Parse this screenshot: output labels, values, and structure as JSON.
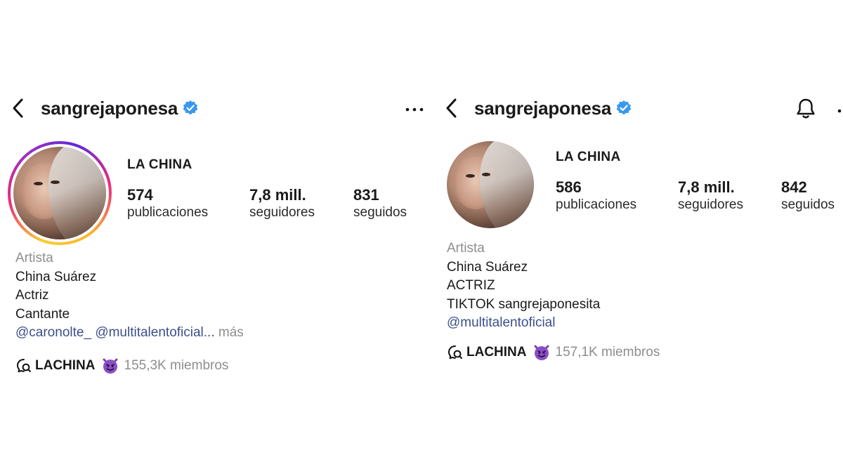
{
  "left": {
    "username": "sangrejaponesa",
    "display_name": "LA CHINA",
    "stats": [
      {
        "value": "574",
        "label": "publicaciones"
      },
      {
        "value": "7,8 mill.",
        "label": "seguidores"
      },
      {
        "value": "831",
        "label": "seguidos"
      }
    ],
    "bio": {
      "category": "Artista",
      "lines": [
        "China Suárez",
        "Actriz",
        "Cantante"
      ],
      "mention_1": "@caronolte_",
      "mention_2": "@multitalentoficial",
      "ellipsis": "...",
      "more": "más"
    },
    "channel": {
      "name": "LACHINA",
      "members": "155,3K miembros"
    }
  },
  "right": {
    "username": "sangrejaponesa",
    "display_name": "LA CHINA",
    "stats": [
      {
        "value": "586",
        "label": "publicaciones"
      },
      {
        "value": "7,8 mill.",
        "label": "seguidores"
      },
      {
        "value": "842",
        "label": "seguidos"
      }
    ],
    "bio": {
      "category": "Artista",
      "lines": [
        "China Suárez",
        "ACTRIZ",
        "TIKTOK sangrejaponesita"
      ],
      "link": "@multitalentoficial"
    },
    "channel": {
      "name": "LACHINA",
      "members": "157,1K miembros"
    }
  },
  "icons": {
    "back": "chevron-left-icon",
    "verified": "verified-badge-icon",
    "more": "more-horizontal-icon",
    "bell": "bell-icon",
    "channel": "broadcast-channel-icon",
    "emoji": "smiling-devil-emoji"
  },
  "colors": {
    "verified": "#3897f0",
    "link": "#3d4f8a",
    "muted": "#8e8e8e",
    "devil": "#8a4fc4"
  }
}
